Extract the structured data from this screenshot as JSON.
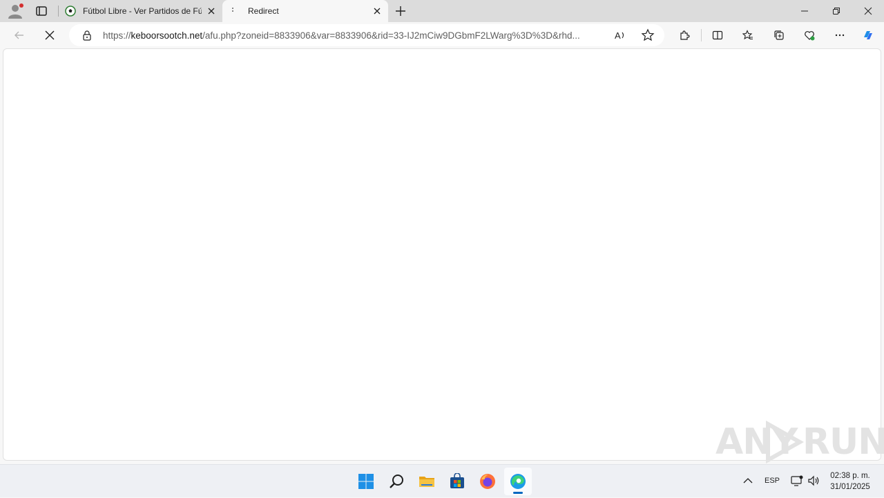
{
  "browser": {
    "tabs": [
      {
        "title": "Fútbol Libre - Ver Partidos de Fútbol",
        "favicon": "soccer-ball-icon",
        "active": false
      },
      {
        "title": "Redirect",
        "favicon": "loading-icon",
        "active": true
      }
    ],
    "address_bar": {
      "url_prefix": "https://",
      "url_host": "keboorsootch.net",
      "url_path": "/afu.php?zoneid=8833906&var=8833906&rid=33-IJ2mCiw9DGbmF2LWarg%3D%3D&rhd..."
    },
    "loading": true
  },
  "watermark": {
    "text_left": "ANY",
    "text_right": "RUN"
  },
  "taskbar": {
    "apps": [
      "start-icon",
      "search-icon",
      "file-explorer-icon",
      "store-icon",
      "firefox-icon",
      "edge-icon"
    ],
    "active_app": "edge-icon",
    "language": "ESP",
    "time": "02:38 p. m.",
    "date": "31/01/2025"
  },
  "colors": {
    "accent": "#0067c0",
    "tab_strip": "#dcdcdc",
    "toolbar": "#f7f7f7"
  }
}
